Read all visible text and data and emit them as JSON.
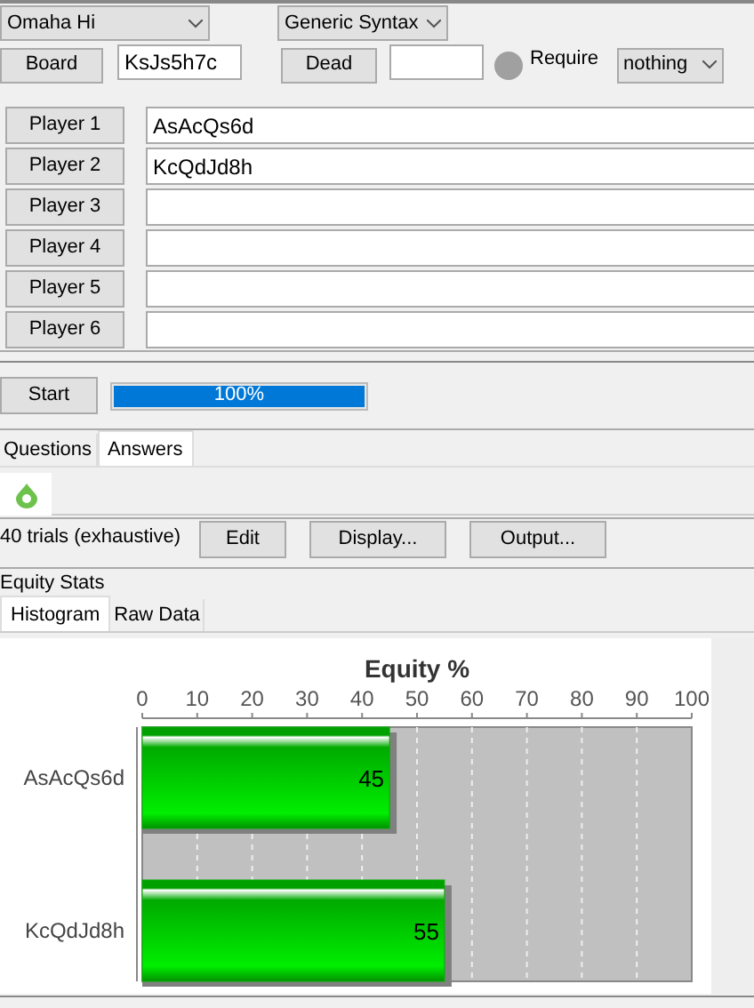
{
  "game_select": {
    "value": "Omaha Hi"
  },
  "syntax_select": {
    "value": "Generic Syntax"
  },
  "board": {
    "label": "Board",
    "value": "KsJs5h7c"
  },
  "dead": {
    "label": "Dead"
  },
  "require": {
    "label": "Require",
    "value": "nothing"
  },
  "players": [
    {
      "label": "Player 1",
      "value": "AsAcQs6d"
    },
    {
      "label": "Player 2",
      "value": "KcQdJd8h"
    },
    {
      "label": "Player 3"
    },
    {
      "label": "Player 4"
    },
    {
      "label": "Player 5"
    },
    {
      "label": "Player 6"
    }
  ],
  "start_button": "Start",
  "progress": {
    "level": 1,
    "reading": "100%"
  },
  "tabs": [
    {
      "label": "Questions",
      "selected": false
    },
    {
      "label": "Answers",
      "selected": true
    }
  ],
  "trials": "40 trials (exhaustive)",
  "actions": [
    "Edit",
    "Display...",
    "Output..."
  ],
  "section_title": "Equity Stats",
  "sub_tabs": [
    {
      "label": "Histogram",
      "selected": true
    },
    {
      "label": "Raw Data",
      "selected": false
    }
  ],
  "chart": {
    "chart_data": {
      "type": "bar",
      "orientation": "horizontal",
      "title": "Equity %",
      "categories": [
        "AsAcQs6d",
        "KcQdJd8h"
      ],
      "series": [
        {
          "color": "#00b000",
          "values": [
            45,
            55
          ]
        }
      ],
      "grid": true,
      "xlim": [
        0,
        100
      ],
      "xticks": [
        0,
        10,
        20,
        30,
        40,
        50,
        60,
        70,
        80,
        90,
        100
      ],
      "data_labels": true
    }
  }
}
